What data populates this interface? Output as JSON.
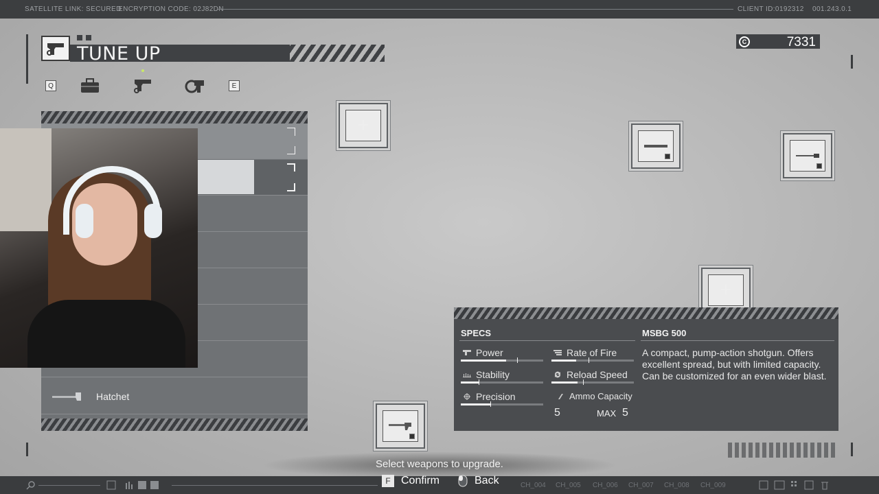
{
  "topbar": {
    "satellite": "SATELLITE LINK: SECURED",
    "encryption": "ENCRYPTION CODE: 02J82DN",
    "client": "CLIENT ID:0192312",
    "version": "001.243.0.1"
  },
  "header": {
    "title": "TUNE UP",
    "key_left": "Q",
    "key_right": "E",
    "tabs": [
      "briefcase-icon",
      "handgun-icon",
      "credit-weapon-icon"
    ]
  },
  "credits": {
    "symbol": "C",
    "value": "7331"
  },
  "weapon_list": {
    "items": [
      {
        "label": "",
        "selected": true
      },
      {
        "label": "",
        "selected": false
      },
      {
        "label": "",
        "selected": false
      },
      {
        "label": "",
        "selected": false
      },
      {
        "label": "",
        "selected": false
      },
      {
        "label": "",
        "selected": false
      },
      {
        "label": "",
        "selected": false
      },
      {
        "label": "Hatchet",
        "selected": false
      }
    ]
  },
  "specs": {
    "header": "SPECS",
    "stats": {
      "power": {
        "label": "Power",
        "value": 0.55,
        "max": 0.68
      },
      "rate_of_fire": {
        "label": "Rate of Fire",
        "value": 0.3,
        "max": 0.45
      },
      "stability": {
        "label": "Stability",
        "value": 0.22,
        "max": 0.22
      },
      "reload_speed": {
        "label": "Reload Speed",
        "value": 0.32,
        "max": 0.38
      },
      "precision": {
        "label": "Precision",
        "value": 0.36,
        "max": 0.36
      }
    },
    "ammo": {
      "label": "Ammo Capacity",
      "value": "5",
      "max_label": "MAX",
      "max_value": "5"
    }
  },
  "weapon": {
    "name": "MSBG 500",
    "description": "A compact, pump-action shotgun. Offers excellent spread, but with limited capacity. Can be customized for an even wider blast."
  },
  "footer": {
    "prompt": "Select weapons to upgrade.",
    "confirm_key": "F",
    "confirm_label": "Confirm",
    "back_label": "Back",
    "channels": [
      "CH_004",
      "CH_005",
      "CH_006",
      "CH_007",
      "CH_008",
      "CH_009"
    ]
  },
  "colors": {
    "panel_dark": "#4a4c4f",
    "accent_light": "#f2f2f2",
    "bar_dark": "#3a3c3e"
  }
}
